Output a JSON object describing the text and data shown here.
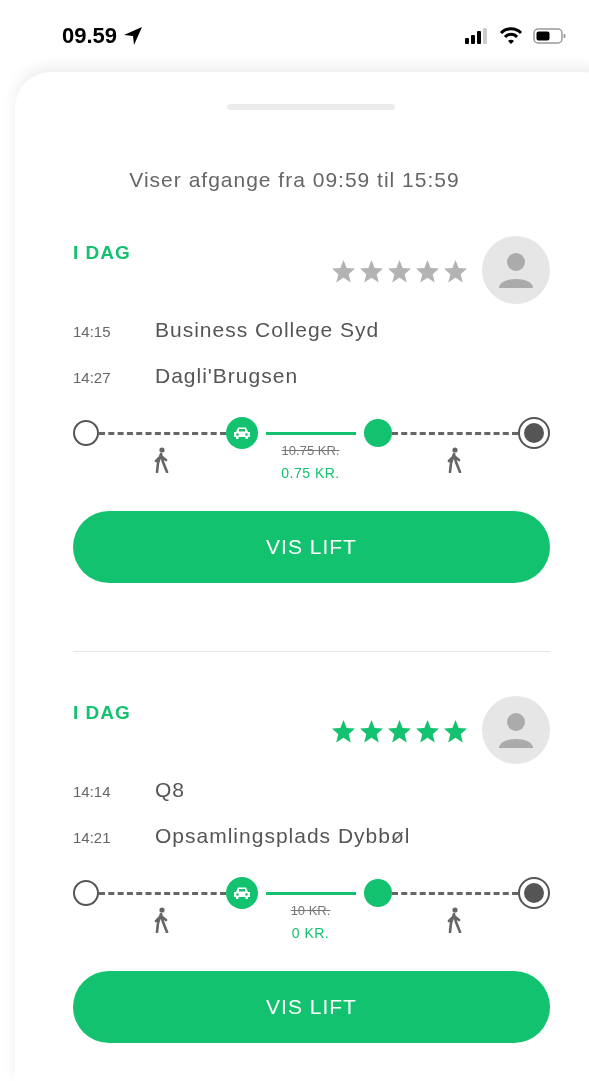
{
  "status_bar": {
    "time": "09.59"
  },
  "header": "Viser afgange fra 09:59 til 15:59",
  "trips": [
    {
      "day": "I DAG",
      "stars": 0,
      "stops": [
        {
          "time": "14:15",
          "name": "Business College Syd"
        },
        {
          "time": "14:27",
          "name": "Dagli'Brugsen"
        }
      ],
      "old_price": "10.75 KR.",
      "price": "0.75 KR.",
      "button": "VIS LIFT"
    },
    {
      "day": "I DAG",
      "stars": 5,
      "stops": [
        {
          "time": "14:14",
          "name": "Q8"
        },
        {
          "time": "14:21",
          "name": "Opsamlingsplads Dybbøl"
        }
      ],
      "old_price": "10 KR.",
      "price": "0 KR.",
      "button": "VIS LIFT"
    }
  ]
}
